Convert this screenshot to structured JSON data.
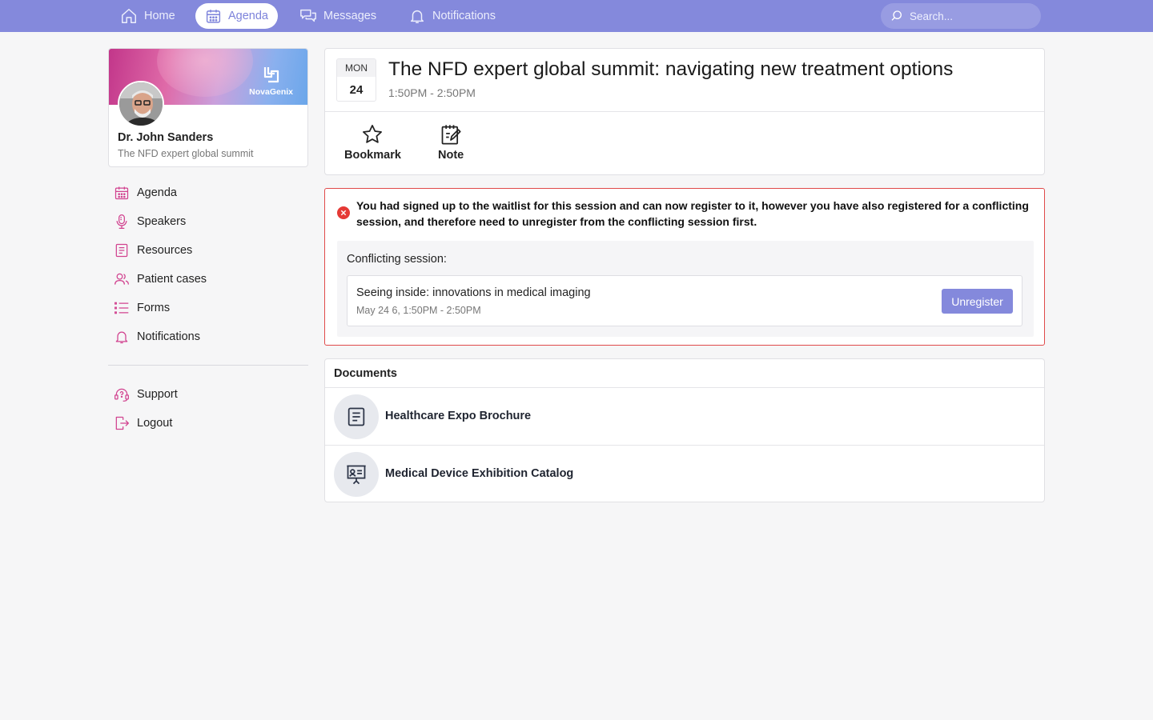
{
  "colors": {
    "accent": "#8489dc",
    "pink": "#c2368a",
    "danger": "#e04a4a"
  },
  "topnav": {
    "items": [
      {
        "label": "Home",
        "icon": "home-icon"
      },
      {
        "label": "Agenda",
        "icon": "calendar-icon",
        "active": true
      },
      {
        "label": "Messages",
        "icon": "messages-icon"
      },
      {
        "label": "Notifications",
        "icon": "bell-icon"
      }
    ],
    "search_placeholder": "Search..."
  },
  "profile": {
    "brand": "NovaGenix",
    "name": "Dr. John Sanders",
    "subtitle": "The NFD expert global summit"
  },
  "sidebar": {
    "items": [
      {
        "label": "Agenda",
        "icon": "calendar-icon"
      },
      {
        "label": "Speakers",
        "icon": "microphone-icon"
      },
      {
        "label": "Resources",
        "icon": "document-icon"
      },
      {
        "label": "Patient cases",
        "icon": "users-icon"
      },
      {
        "label": "Forms",
        "icon": "list-icon"
      },
      {
        "label": "Notifications",
        "icon": "bell-icon"
      }
    ],
    "bottom_items": [
      {
        "label": "Support",
        "icon": "headset-icon"
      },
      {
        "label": "Logout",
        "icon": "logout-icon"
      }
    ]
  },
  "session": {
    "day_of_week": "MON",
    "day": "24",
    "title": "The NFD expert global summit: navigating new treatment options",
    "time": "1:50PM - 2:50PM",
    "actions": [
      {
        "label": "Bookmark",
        "icon": "star-icon"
      },
      {
        "label": "Note",
        "icon": "note-icon"
      }
    ]
  },
  "alert": {
    "message": "You had signed up to the waitlist for this session and can now register to it, however you have also registered for a conflicting session, and therefore need to unregister from the conflicting session first.",
    "conflict_label": "Conflicting session:",
    "conflict": {
      "title": "Seeing inside: innovations in medical imaging",
      "time": "May 24 6, 1:50PM - 2:50PM",
      "button": "Unregister"
    }
  },
  "documents": {
    "heading": "Documents",
    "items": [
      {
        "title": "Healthcare Expo Brochure",
        "icon": "document-icon"
      },
      {
        "title": "Medical Device Exhibition Catalog",
        "icon": "presentation-icon"
      }
    ]
  }
}
